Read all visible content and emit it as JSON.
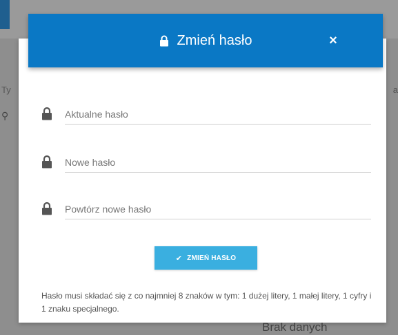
{
  "background": {
    "left_text": "Ty",
    "right_text": "a",
    "empty_text": "Brak danych"
  },
  "modal": {
    "title": "Zmień hasło",
    "close_label": "×",
    "fields": [
      {
        "placeholder": "Aktualne hasło",
        "value": ""
      },
      {
        "placeholder": "Nowe hasło",
        "value": ""
      },
      {
        "placeholder": "Powtórz nowe hasło",
        "value": ""
      }
    ],
    "submit_label": "ZMIEŃ HASŁO",
    "hint": "Hasło musi składać się z co najmniej 8 znaków w tym: 1 dużej litery, 1 małej litery, 1 cyfry i 1 znaku specjalnego."
  },
  "colors": {
    "header": "#0a78c5",
    "button": "#3aafe0",
    "icon": "#555555"
  },
  "icons": {
    "header": "lock-icon",
    "field": "lock-icon",
    "button": "check-icon",
    "close": "close-icon"
  }
}
